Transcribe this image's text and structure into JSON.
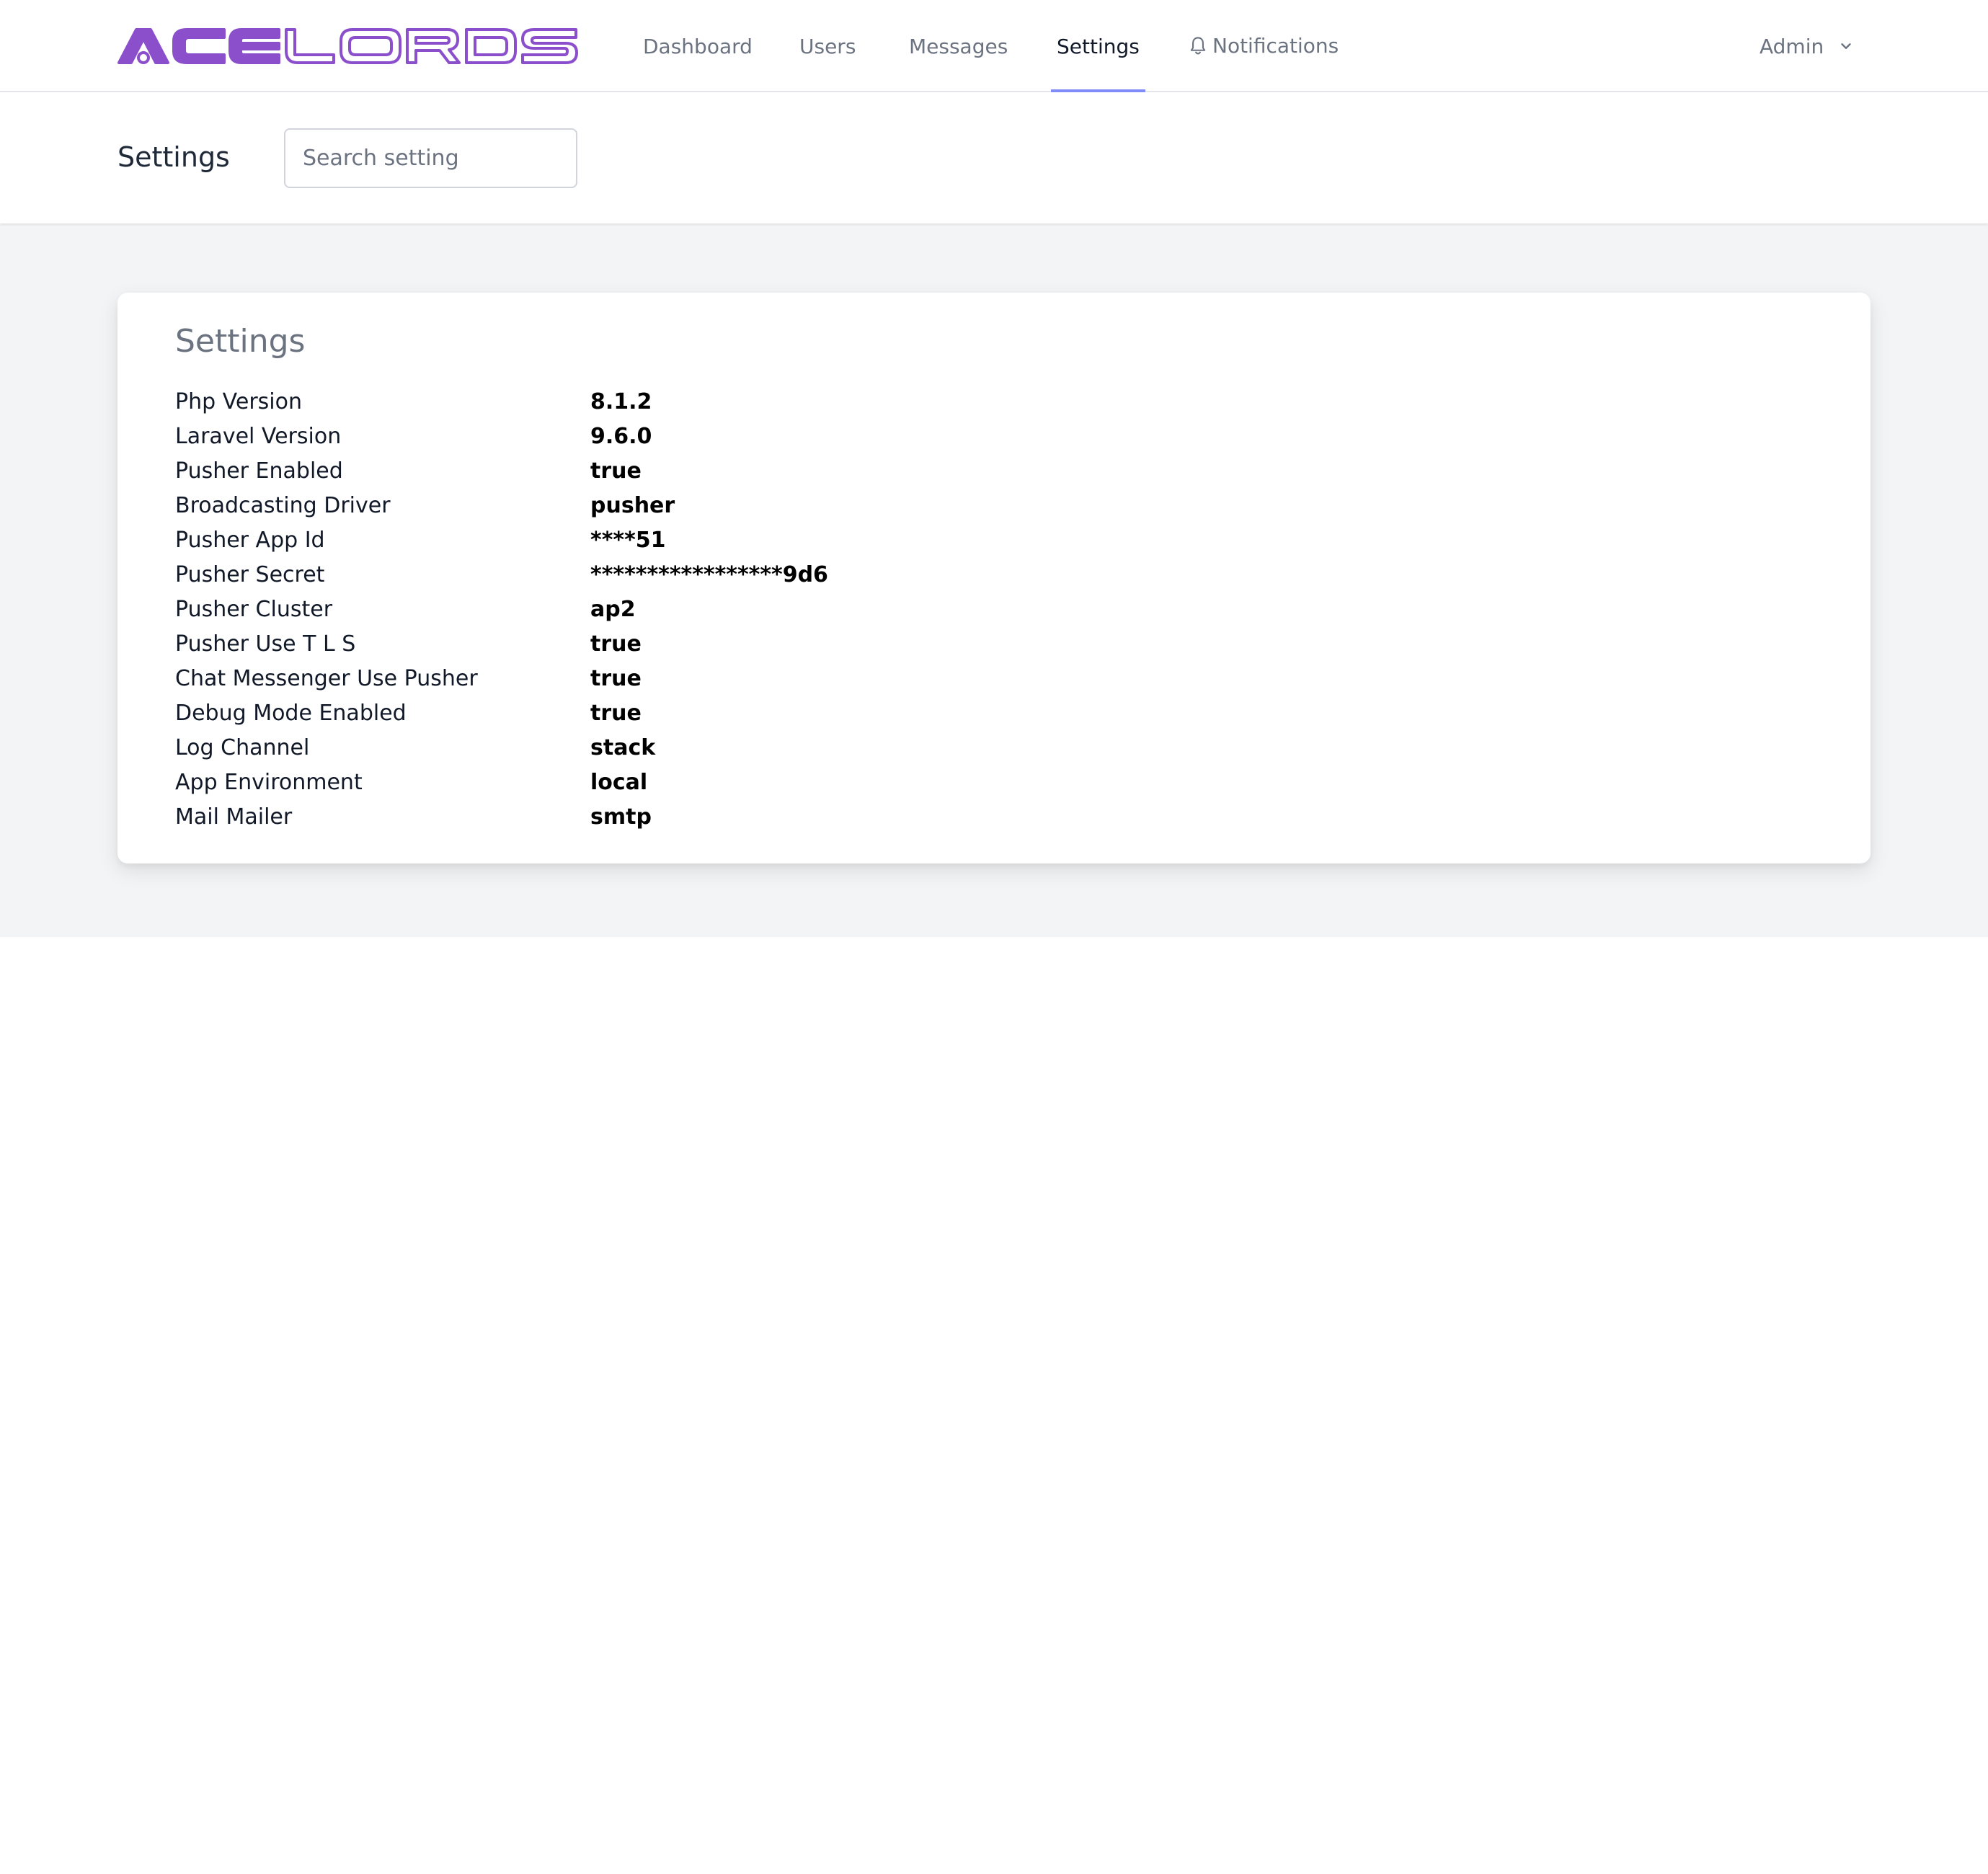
{
  "brand": {
    "logo_text": "ACELORDS",
    "logo_color": "#8b4fcc"
  },
  "nav": {
    "links": [
      {
        "label": "Dashboard"
      },
      {
        "label": "Users"
      },
      {
        "label": "Messages"
      },
      {
        "label": "Settings",
        "active": true
      },
      {
        "label": "Notifications",
        "icon": "bell-icon"
      }
    ],
    "user_menu": {
      "label": "Admin",
      "icon": "chevron-down-icon"
    },
    "active_color": "#818cf8"
  },
  "header": {
    "title": "Settings",
    "search": {
      "placeholder": "Search setting",
      "value": ""
    }
  },
  "card": {
    "title": "Settings",
    "rows": [
      {
        "key": "Php Version",
        "value": "8.1.2"
      },
      {
        "key": "Laravel Version",
        "value": "9.6.0"
      },
      {
        "key": "Pusher Enabled",
        "value": "true"
      },
      {
        "key": "Broadcasting Driver",
        "value": "pusher"
      },
      {
        "key": "Pusher App Id",
        "value": "****51"
      },
      {
        "key": "Pusher Secret",
        "value": "*****************9d6"
      },
      {
        "key": "Pusher Cluster",
        "value": "ap2"
      },
      {
        "key": "Pusher Use T L S",
        "value": "true"
      },
      {
        "key": "Chat Messenger Use Pusher",
        "value": "true"
      },
      {
        "key": "Debug Mode Enabled",
        "value": "true"
      },
      {
        "key": "Log Channel",
        "value": "stack"
      },
      {
        "key": "App Environment",
        "value": "local"
      },
      {
        "key": "Mail Mailer",
        "value": "smtp"
      }
    ]
  }
}
